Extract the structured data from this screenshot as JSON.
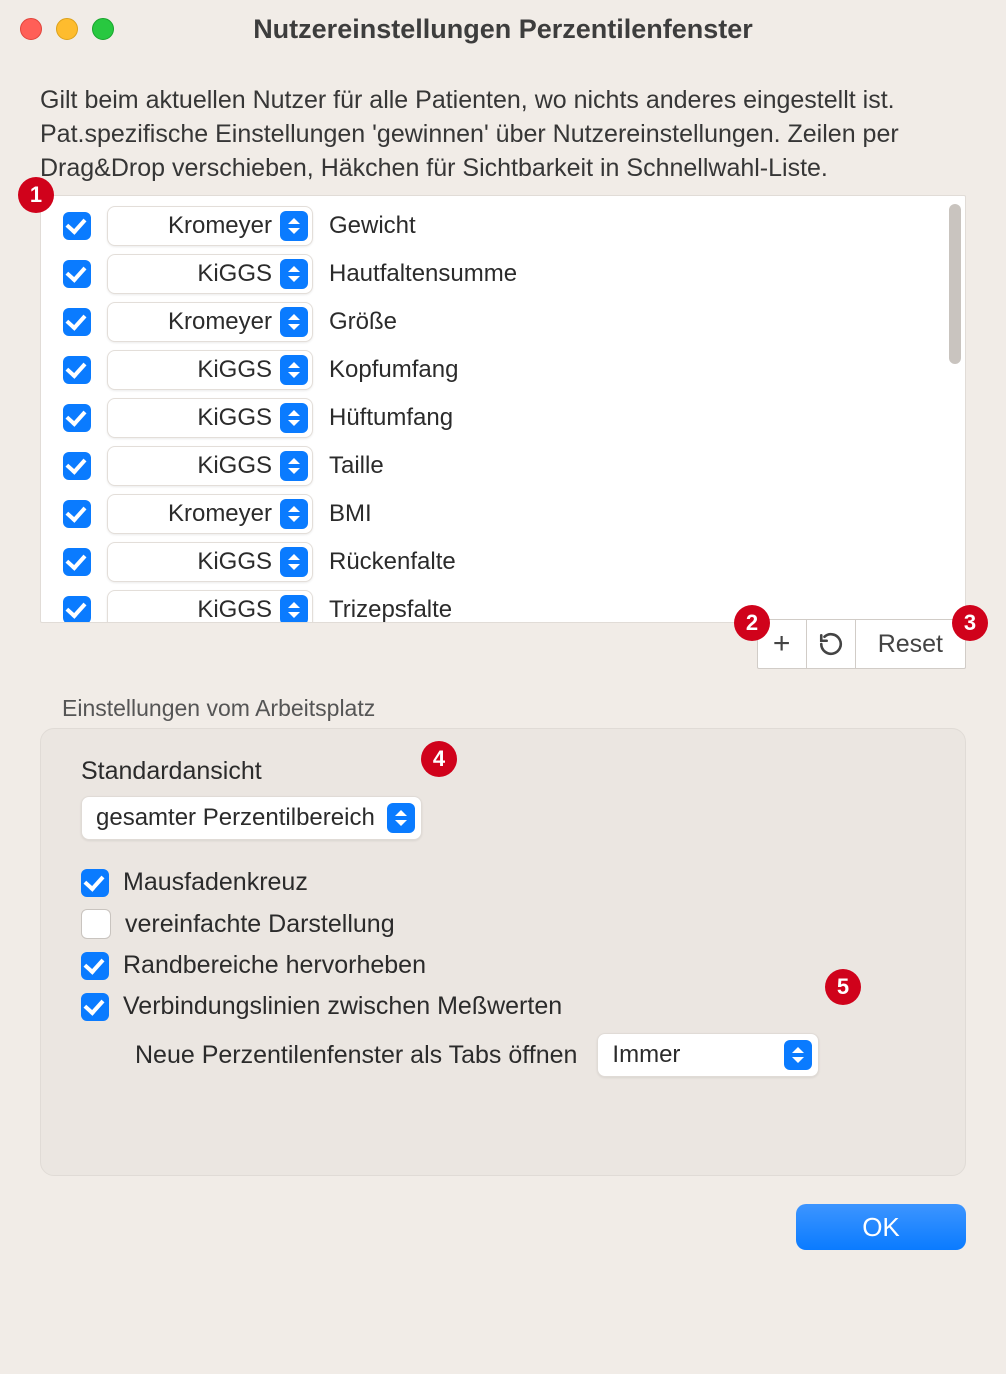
{
  "window": {
    "title": "Nutzereinstellungen Perzentilenfenster"
  },
  "description": "Gilt beim aktuellen Nutzer für alle Patienten, wo nichts anderes eingestellt ist. Pat.spezifische Einstellungen 'gewinnen' über Nutzereinstellungen. Zeilen per Drag&Drop verschieben, Häkchen für Sichtbarkeit in Schnellwahl-Liste.",
  "list": {
    "rows": [
      {
        "checked": true,
        "source": "Kromeyer",
        "measure": "Gewicht"
      },
      {
        "checked": true,
        "source": "KiGGS",
        "measure": "Hautfaltensumme"
      },
      {
        "checked": true,
        "source": "Kromeyer",
        "measure": "Größe"
      },
      {
        "checked": true,
        "source": "KiGGS",
        "measure": "Kopfumfang"
      },
      {
        "checked": true,
        "source": "KiGGS",
        "measure": "Hüftumfang"
      },
      {
        "checked": true,
        "source": "KiGGS",
        "measure": "Taille"
      },
      {
        "checked": true,
        "source": "Kromeyer",
        "measure": "BMI"
      },
      {
        "checked": true,
        "source": "KiGGS",
        "measure": "Rückenfalte"
      },
      {
        "checked": true,
        "source": "KiGGS",
        "measure": "Trizepsfalte"
      }
    ]
  },
  "actions": {
    "add_label": "+",
    "reset_label": "Reset"
  },
  "workplace": {
    "section_label": "Einstellungen vom Arbeitsplatz",
    "standard_view_label": "Standardansicht",
    "standard_view_value": "gesamter Perzentilbereich",
    "crosshair": {
      "checked": true,
      "label": "Mausfadenkreuz"
    },
    "simplified": {
      "checked": false,
      "label": "vereinfachte Darstellung"
    },
    "highlight_edges": {
      "checked": true,
      "label": "Randbereiche hervorheben"
    },
    "connect_lines": {
      "checked": true,
      "label": "Verbindungslinien zwischen Meßwerten"
    },
    "open_tabs_label": "Neue Perzentilenfenster als Tabs öffnen",
    "open_tabs_value": "Immer"
  },
  "buttons": {
    "ok": "OK"
  },
  "annotations": {
    "b1": "1",
    "b2": "2",
    "b3": "3",
    "b4": "4",
    "b5": "5"
  }
}
